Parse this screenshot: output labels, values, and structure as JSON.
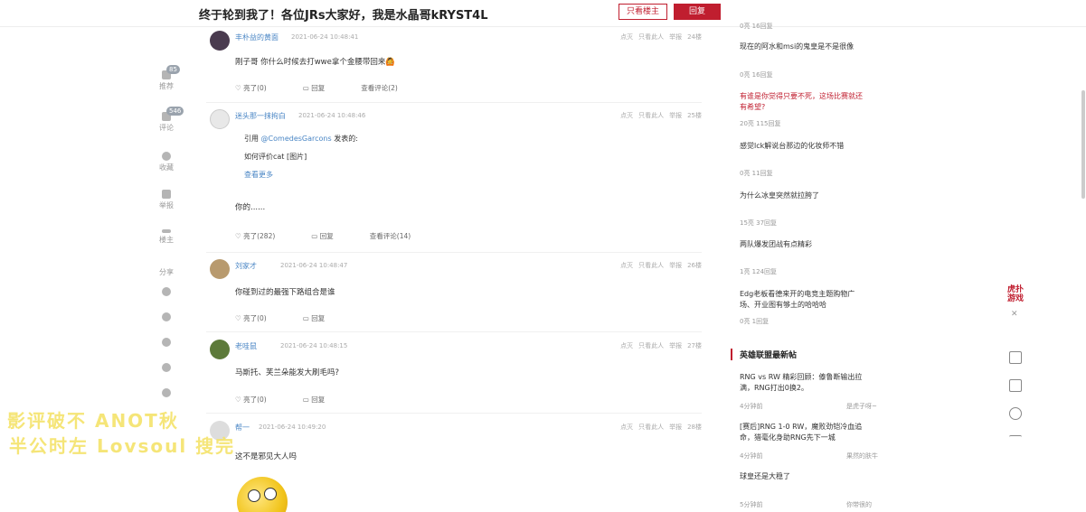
{
  "header": {
    "title": "终于轮到我了！各位JRs大家好，我是水晶哥kRYST4L",
    "only_op": "只看楼主",
    "reply": "回复"
  },
  "rail": [
    {
      "icon": "recommend-icon",
      "label": "推荐",
      "badge": "85"
    },
    {
      "icon": "comment-icon",
      "label": "评论",
      "badge": "546"
    },
    {
      "icon": "star-icon",
      "label": "收藏",
      "badge": ""
    },
    {
      "icon": "warning-icon",
      "label": "举报",
      "badge": ""
    },
    {
      "icon": "floor-icon",
      "label": "楼主",
      "badge": ""
    },
    {
      "icon": "share-icon",
      "label": "分享",
      "badge": ""
    }
  ],
  "posts": [
    {
      "user": "丰朴益的黄面",
      "time": "2021-06-24 10:48:41",
      "floor": "24楼",
      "body": "刚子哥 你什么时候去打wwe拿个金腰带回来🙆",
      "light": "亮了(0)",
      "reply": "回复",
      "view": "查看评论(2)"
    },
    {
      "user": "迷头那一抹拘白",
      "time": "2021-06-24 10:48:46",
      "floor": "25楼",
      "quote_prefix": "引用 ",
      "quote_user": "@ComedesGarcons",
      "quote_suffix": " 发表的:",
      "quote_text": "如何评价cat [图片]",
      "quote_more": "查看更多",
      "body": "你的......",
      "light": "亮了(282)",
      "reply": "回复",
      "view": "查看评论(14)"
    },
    {
      "user": "刘家才",
      "time": "2021-06-24 10:48:47",
      "floor": "26楼",
      "body": "你碰到过的最强下路组合是谁",
      "light": "亮了(0)",
      "reply": "回复",
      "view": ""
    },
    {
      "user": "老哇鼠",
      "time": "2021-06-24 10:48:15",
      "floor": "27楼",
      "body": "马斯托、芙兰朵能发大刷毛吗?",
      "light": "亮了(0)",
      "reply": "回复",
      "view": ""
    },
    {
      "user": "帮一",
      "time": "2021-06-24 10:49:20",
      "floor": "28楼",
      "body": "这不是邪见大人吗",
      "light": "",
      "reply": "",
      "view": ""
    }
  ],
  "post_actions": {
    "dislike": "点灭",
    "only_this": "只看此人",
    "report": "举报"
  },
  "sidebar": {
    "top_items": [
      {
        "title": "",
        "meta": "0亮 16回复",
        "red": false
      },
      {
        "title": "现在的阿水和msi的鬼皇是不是很像",
        "meta": "0亮 16回复",
        "red": false
      },
      {
        "title": "有谁是你觉得只要不死，这场比赛就还有希望?",
        "meta": "20亮 115回复",
        "red": true
      },
      {
        "title": "感觉lck解说台那边的化妆师不错",
        "meta": "0亮 11回复",
        "red": false
      },
      {
        "title": "为什么冰皇突然就拉胯了",
        "meta": "15亮 37回复",
        "red": false
      },
      {
        "title": "两队爆发团战有点精彩",
        "meta": "1亮 124回复",
        "red": false
      },
      {
        "title": "Edg老板看德来开的电竞主题购物广场、开业图有够土的哈哈哈",
        "meta": "0亮 1回复",
        "red": false
      }
    ],
    "section_title": "英雄联盟最新帖",
    "latest": [
      {
        "title": "RNG vs RW 精彩回顾：傣鲁断输出拉满，RNG打出0换2。",
        "time": "4分钟前",
        "author": "是虎子呀~"
      },
      {
        "title": "[赛后]RNG 1-0 RW，魔败劲铠冷血追命，猎毫化身助RNG先下一城",
        "time": "4分钟前",
        "author": "果然的肤牛"
      },
      {
        "title": "球皇还是大稳了",
        "time": "5分钟前",
        "author": "你带很的"
      }
    ]
  },
  "logo_text": "虎扑游戏",
  "overlay_subtitles": [
    "影评破不 ANOT秋",
    "半公时左 Lovsoul 搜完"
  ]
}
